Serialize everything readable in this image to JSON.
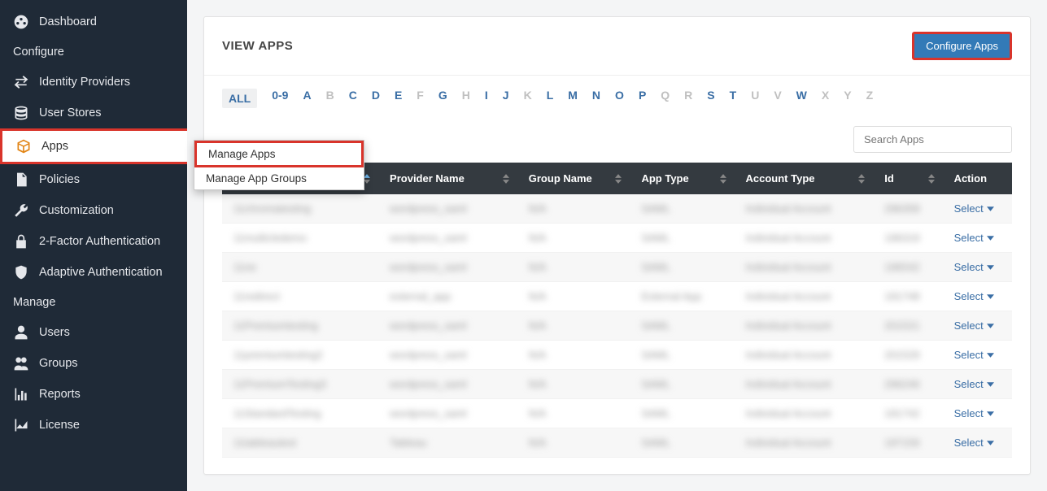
{
  "sidebar": {
    "dashboard": "Dashboard",
    "section_configure": "Configure",
    "identity_providers": "Identity Providers",
    "user_stores": "User Stores",
    "apps": "Apps",
    "policies": "Policies",
    "customization": "Customization",
    "two_factor": "2-Factor Authentication",
    "adaptive_auth": "Adaptive Authentication",
    "section_manage": "Manage",
    "users": "Users",
    "groups": "Groups",
    "reports": "Reports",
    "license": "License"
  },
  "header": {
    "title": "VIEW APPS",
    "configure_btn": "Configure Apps"
  },
  "alpha": {
    "all": "ALL",
    "items": [
      {
        "label": "0-9",
        "enabled": true
      },
      {
        "label": "A",
        "enabled": true
      },
      {
        "label": "B",
        "enabled": false
      },
      {
        "label": "C",
        "enabled": true
      },
      {
        "label": "D",
        "enabled": true
      },
      {
        "label": "E",
        "enabled": true
      },
      {
        "label": "F",
        "enabled": false
      },
      {
        "label": "G",
        "enabled": true
      },
      {
        "label": "H",
        "enabled": false
      },
      {
        "label": "I",
        "enabled": true
      },
      {
        "label": "J",
        "enabled": true
      },
      {
        "label": "K",
        "enabled": false
      },
      {
        "label": "L",
        "enabled": true
      },
      {
        "label": "M",
        "enabled": true
      },
      {
        "label": "N",
        "enabled": true
      },
      {
        "label": "O",
        "enabled": true
      },
      {
        "label": "P",
        "enabled": true
      },
      {
        "label": "Q",
        "enabled": false
      },
      {
        "label": "R",
        "enabled": false
      },
      {
        "label": "S",
        "enabled": true
      },
      {
        "label": "T",
        "enabled": true
      },
      {
        "label": "U",
        "enabled": false
      },
      {
        "label": "V",
        "enabled": false
      },
      {
        "label": "W",
        "enabled": true
      },
      {
        "label": "X",
        "enabled": false
      },
      {
        "label": "Y",
        "enabled": false
      },
      {
        "label": "Z",
        "enabled": false
      }
    ]
  },
  "search": {
    "placeholder": "Search Apps"
  },
  "dropdown": {
    "manage_apps": "Manage Apps",
    "manage_app_groups": "Manage App Groups"
  },
  "table": {
    "headers": {
      "provider_name": "Provider Name",
      "group_name": "Group Name",
      "app_type": "App Type",
      "account_type": "Account Type",
      "id": "Id",
      "action": "Action"
    },
    "select_label": "Select",
    "rows": [
      {
        "name": "11chromatesting",
        "provider": "wordpress_saml",
        "group": "N/A",
        "type": "SAML",
        "account": "Individual Account",
        "id": "296358"
      },
      {
        "name": "11multicledemo",
        "provider": "wordpress_saml",
        "group": "N/A",
        "type": "SAML",
        "account": "Individual Account",
        "id": "196319"
      },
      {
        "name": "11ne",
        "provider": "wordpress_saml",
        "group": "N/A",
        "type": "SAML",
        "account": "Individual Account",
        "id": "196542"
      },
      {
        "name": "11redirect",
        "provider": "external_app",
        "group": "N/A",
        "type": "External App",
        "account": "Individual Account",
        "id": "191748"
      },
      {
        "name": "11Premiumtesting",
        "provider": "wordpress_saml",
        "group": "N/A",
        "type": "SAML",
        "account": "Individual Account",
        "id": "201521"
      },
      {
        "name": "11premiumtesting2",
        "provider": "wordpress_saml",
        "group": "N/A",
        "type": "SAML",
        "account": "Individual Account",
        "id": "201529"
      },
      {
        "name": "11PremiumTesting3",
        "provider": "wordpress_saml",
        "group": "N/A",
        "type": "SAML",
        "account": "Individual Account",
        "id": "296246"
      },
      {
        "name": "11StandardTesting",
        "provider": "wordpress_saml",
        "group": "N/A",
        "type": "SAML",
        "account": "Individual Account",
        "id": "191742"
      },
      {
        "name": "11tableautest",
        "provider": "Tableau",
        "group": "N/A",
        "type": "SAML",
        "account": "Individual Account",
        "id": "197156"
      }
    ]
  }
}
